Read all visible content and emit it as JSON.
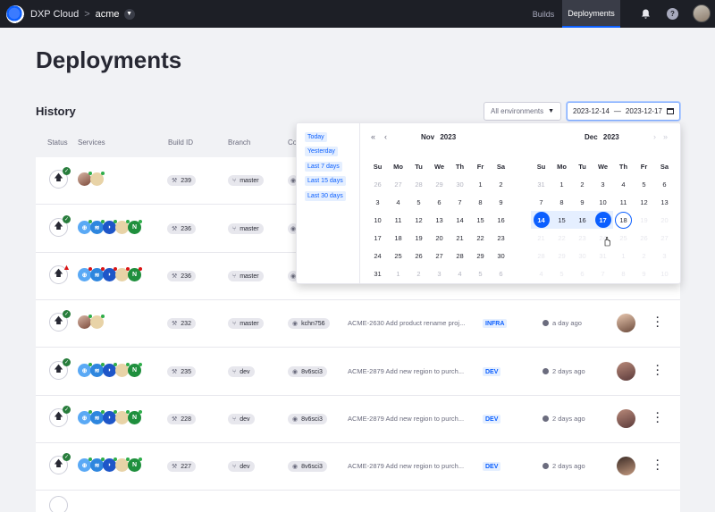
{
  "topbar": {
    "brand": "DXP Cloud",
    "separator": ">",
    "project": "acme",
    "nav_builds": "Builds",
    "nav_deployments": "Deployments"
  },
  "page": {
    "title": "Deployments",
    "section": "History"
  },
  "filters": {
    "environment": "All environments",
    "date_start": "2023-12-14",
    "date_separator": "—",
    "date_end": "2023-12-17"
  },
  "table": {
    "headers": {
      "status": "Status",
      "services": "Services",
      "build_id": "Build ID",
      "branch": "Branch",
      "commit": "Co"
    },
    "rows": [
      {
        "build": "239",
        "branch": "master",
        "status": "success"
      },
      {
        "build": "236",
        "branch": "master",
        "status": "success"
      },
      {
        "build": "236",
        "branch": "master",
        "status": "failed"
      },
      {
        "build": "232",
        "branch": "master",
        "commit": "kchn756",
        "desc": "ACME-2630 Add product rename proj...",
        "tag": "INFRA",
        "time": "a day ago",
        "status": "success"
      },
      {
        "build": "235",
        "branch": "dev",
        "commit": "8v6sci3",
        "desc": "ACME-2879 Add new region to purch...",
        "tag": "DEV",
        "time": "2 days ago",
        "status": "success"
      },
      {
        "build": "228",
        "branch": "dev",
        "commit": "8v6sci3",
        "desc": "ACME-2879 Add new region to purch...",
        "tag": "DEV",
        "time": "2 days ago",
        "status": "success"
      },
      {
        "build": "227",
        "branch": "dev",
        "commit": "8v6sci3",
        "desc": "ACME-2879 Add new region to purch...",
        "tag": "DEV",
        "time": "2 days ago",
        "status": "success"
      }
    ]
  },
  "picker": {
    "presets": [
      "Today",
      "Yesterday",
      "Last 7 days",
      "Last 15 days",
      "Last 30 days"
    ],
    "weekdays": [
      "Su",
      "Mo",
      "Tu",
      "We",
      "Th",
      "Fr",
      "Sa"
    ],
    "left_month": {
      "month": "Nov",
      "year": "2023",
      "days": [
        "26",
        "27",
        "28",
        "29",
        "30",
        "1",
        "2",
        "3",
        "4",
        "5",
        "6",
        "7",
        "8",
        "9",
        "10",
        "11",
        "12",
        "13",
        "14",
        "15",
        "16",
        "17",
        "18",
        "19",
        "20",
        "21",
        "22",
        "23",
        "24",
        "25",
        "26",
        "27",
        "28",
        "29",
        "30",
        "31",
        "1",
        "2",
        "3",
        "4",
        "5",
        "6"
      ]
    },
    "right_month": {
      "month": "Dec",
      "year": "2023",
      "days": [
        "31",
        "1",
        "2",
        "3",
        "4",
        "5",
        "6",
        "7",
        "8",
        "9",
        "10",
        "11",
        "12",
        "13",
        "14",
        "15",
        "16",
        "17",
        "18",
        "19",
        "20",
        "21",
        "22",
        "23",
        "24",
        "25",
        "26",
        "27",
        "28",
        "29",
        "30",
        "31",
        "1",
        "2",
        "3",
        "4",
        "5",
        "6",
        "7",
        "8",
        "9",
        "10"
      ]
    }
  },
  "colors": {
    "accent": "#0b5fff",
    "topbar": "#1d1f26",
    "success": "#287d3c",
    "danger": "#da1414"
  }
}
